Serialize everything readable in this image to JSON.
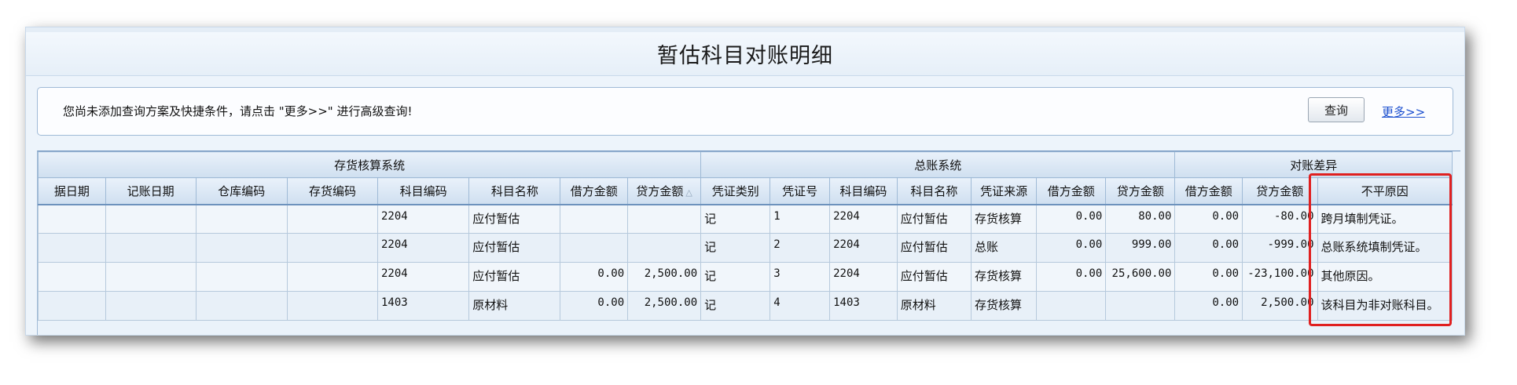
{
  "window": {
    "title": "暂估科目对账明细"
  },
  "query": {
    "message": "您尚未添加查询方案及快捷条件，请点击 \"更多>>\" 进行高级查询!",
    "query_button": "查询",
    "more_link": "更多>>"
  },
  "table": {
    "groups": [
      "存货核算系统",
      "总账系统",
      "对账差异"
    ],
    "columns": [
      "据日期",
      "记账日期",
      "仓库编码",
      "存货编码",
      "科目编码",
      "科目名称",
      "借方金额",
      "贷方金额",
      "凭证类别",
      "凭证号",
      "科目编码",
      "科目名称",
      "凭证来源",
      "借方金额",
      "贷方金额",
      "借方金额",
      "贷方金额",
      "不平原因"
    ],
    "sort_indicator": "△",
    "rows": [
      [
        "",
        "",
        "",
        "",
        "2204",
        "应付暂估",
        "",
        "",
        "记",
        "1",
        "2204",
        "应付暂估",
        "存货核算",
        "0.00",
        "80.00",
        "0.00",
        "-80.00",
        "跨月填制凭证。"
      ],
      [
        "",
        "",
        "",
        "",
        "2204",
        "应付暂估",
        "",
        "",
        "记",
        "2",
        "2204",
        "应付暂估",
        "总账",
        "0.00",
        "999.00",
        "0.00",
        "-999.00",
        "总账系统填制凭证。"
      ],
      [
        "",
        "",
        "",
        "",
        "2204",
        "应付暂估",
        "0.00",
        "2,500.00",
        "记",
        "3",
        "2204",
        "应付暂估",
        "存货核算",
        "0.00",
        "25,600.00",
        "0.00",
        "-23,100.00",
        "其他原因。"
      ],
      [
        "",
        "",
        "",
        "",
        "1403",
        "原材料",
        "0.00",
        "2,500.00",
        "记",
        "4",
        "1403",
        "原材料",
        "存货核算",
        "",
        "",
        "0.00",
        "2,500.00",
        "该科目为非对账科目。"
      ]
    ]
  },
  "colors": {
    "highlight": "#e02020",
    "link": "#1b4fcf",
    "header_border": "#6d92bd"
  }
}
